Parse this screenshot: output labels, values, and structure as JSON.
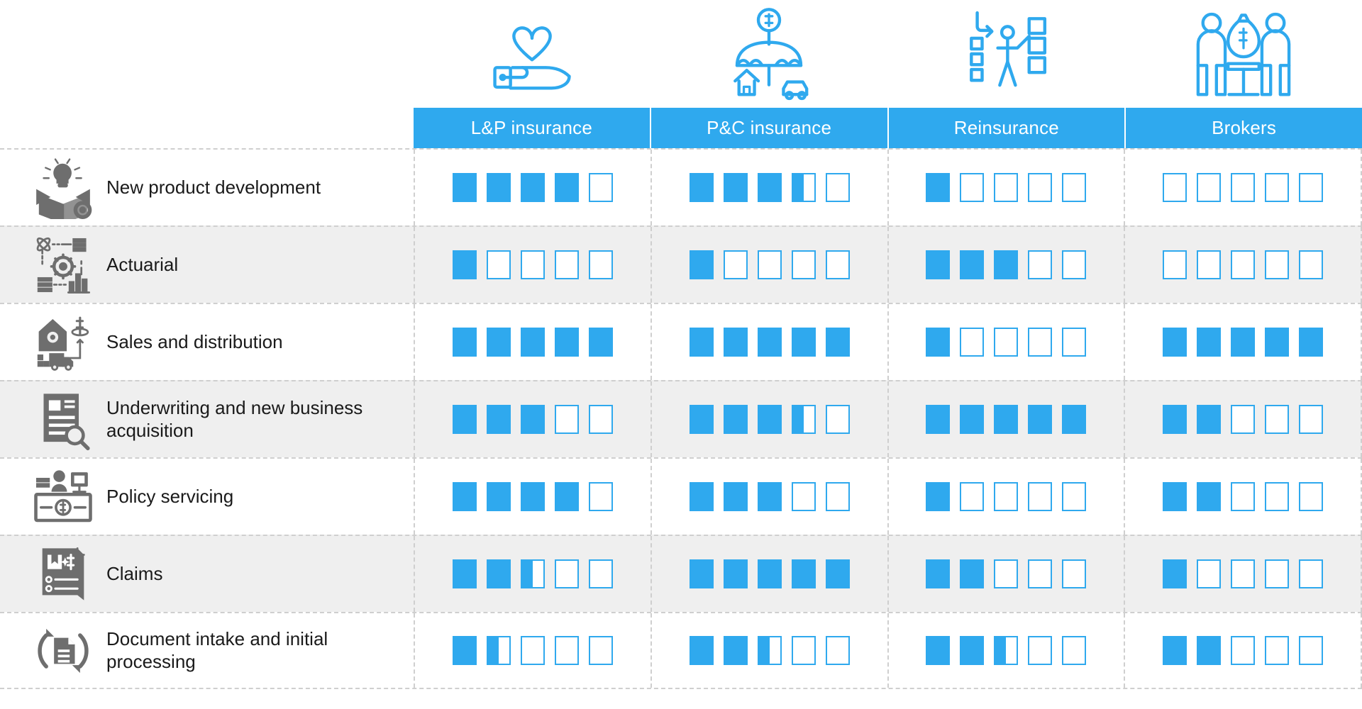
{
  "columns": [
    {
      "label": "L&P insurance",
      "icon": "heart-in-hand-icon"
    },
    {
      "label": "P&C insurance",
      "icon": "umbrella-house-car-icon"
    },
    {
      "label": "Reinsurance",
      "icon": "person-at-board-icon"
    },
    {
      "label": "Brokers",
      "icon": "two-people-money-bag-icon"
    }
  ],
  "rows": [
    {
      "label": "New product development",
      "icon": "open-box-lightbulb-gear-icon"
    },
    {
      "label": "Actuarial",
      "icon": "atom-gear-chart-icon"
    },
    {
      "label": "Sales and distribution",
      "icon": "house-gear-dollar-truck-icon"
    },
    {
      "label": "Underwriting and new business acquisition",
      "icon": "document-magnifier-icon"
    },
    {
      "label": "Policy servicing",
      "icon": "service-desk-dollar-icon"
    },
    {
      "label": "Claims",
      "icon": "claim-document-dollar-icon"
    },
    {
      "label": "Document intake and initial processing",
      "icon": "document-refresh-cycle-icon"
    }
  ],
  "colors": {
    "accent": "#2fa9ee",
    "header_text": "#ffffff",
    "row_alt_background": "#efefef",
    "row_background": "#ffffff",
    "grid_line": "#cfcfcf",
    "label_text": "#1a1a1a",
    "row_icon": "#6e6e6e"
  },
  "chart_data": {
    "type": "heatmap",
    "title": "",
    "scale_max": 5,
    "scale_step": 0.5,
    "legend": [],
    "xlabel": "",
    "ylabel": "",
    "categories": [
      "L&P insurance",
      "P&C insurance",
      "Reinsurance",
      "Brokers"
    ],
    "rows": [
      "New product development",
      "Actuarial",
      "Sales and distribution",
      "Underwriting and new business acquisition",
      "Policy servicing",
      "Claims",
      "Document intake and initial processing"
    ],
    "series": [
      {
        "name": "L&P insurance",
        "values": [
          4,
          1,
          5,
          3,
          4,
          2.5,
          1.5
        ]
      },
      {
        "name": "P&C insurance",
        "values": [
          3.5,
          1,
          5,
          3.5,
          3,
          5,
          2.5
        ]
      },
      {
        "name": "Reinsurance",
        "values": [
          1,
          3,
          1,
          5,
          1,
          2,
          2.5
        ]
      },
      {
        "name": "Brokers",
        "values": [
          0,
          0,
          5,
          2,
          2,
          1,
          2
        ]
      }
    ],
    "matrix": [
      [
        4,
        3.5,
        1,
        0
      ],
      [
        1,
        1,
        3,
        0
      ],
      [
        5,
        5,
        1,
        5
      ],
      [
        3,
        3.5,
        5,
        2
      ],
      [
        4,
        3,
        1,
        2
      ],
      [
        2.5,
        5,
        2,
        1
      ],
      [
        1.5,
        2.5,
        2.5,
        2
      ]
    ]
  }
}
